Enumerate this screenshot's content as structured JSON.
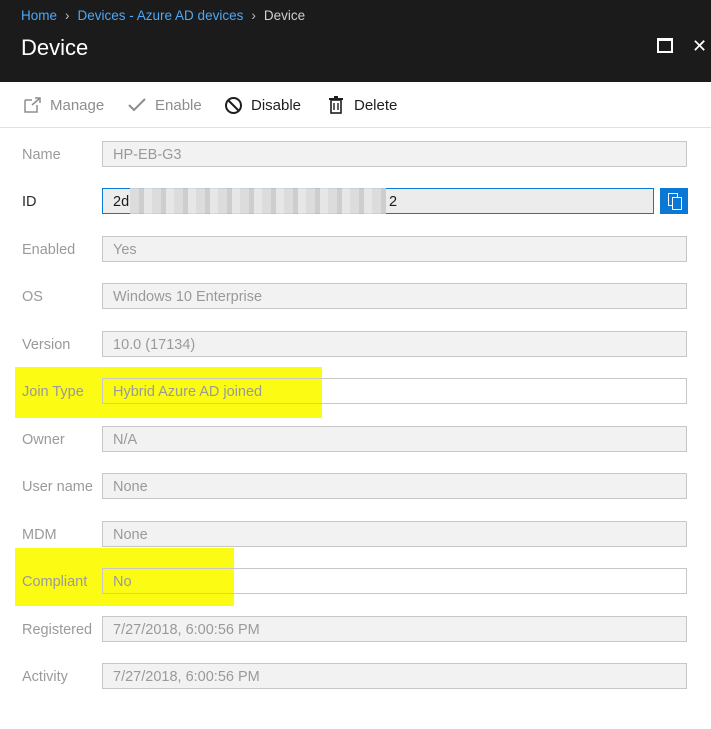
{
  "breadcrumb": {
    "home": "Home",
    "devices": "Devices - Azure AD devices",
    "current": "Device"
  },
  "title": "Device",
  "toolbar": {
    "manage": "Manage",
    "enable": "Enable",
    "disable": "Disable",
    "delete": "Delete"
  },
  "fields": {
    "name": {
      "label": "Name",
      "value": "HP-EB-G3"
    },
    "id": {
      "label": "ID",
      "value_start": "2d",
      "value_end": "2"
    },
    "enabled": {
      "label": "Enabled",
      "value": "Yes"
    },
    "os": {
      "label": "OS",
      "value": "Windows 10 Enterprise"
    },
    "version": {
      "label": "Version",
      "value": "10.0 (17134)"
    },
    "join_type": {
      "label": "Join Type",
      "value": "Hybrid Azure AD joined"
    },
    "owner": {
      "label": "Owner",
      "value": "N/A"
    },
    "user_name": {
      "label": "User name",
      "value": "None"
    },
    "mdm": {
      "label": "MDM",
      "value": "None"
    },
    "compliant": {
      "label": "Compliant",
      "value": "No"
    },
    "registered": {
      "label": "Registered",
      "value": "7/27/2018, 6:00:56 PM"
    },
    "activity": {
      "label": "Activity",
      "value": "7/27/2018, 6:00:56 PM"
    }
  },
  "colors": {
    "highlight": "#fbfb13",
    "accent": "#0a78d4",
    "header_bg": "#1b1b1b"
  },
  "icons": {
    "manage": "external-link-icon",
    "enable": "checkmark-icon",
    "disable": "block-icon",
    "delete": "trash-icon",
    "copy": "copy-icon",
    "maximize": "maximize-icon",
    "close": "close-icon"
  }
}
